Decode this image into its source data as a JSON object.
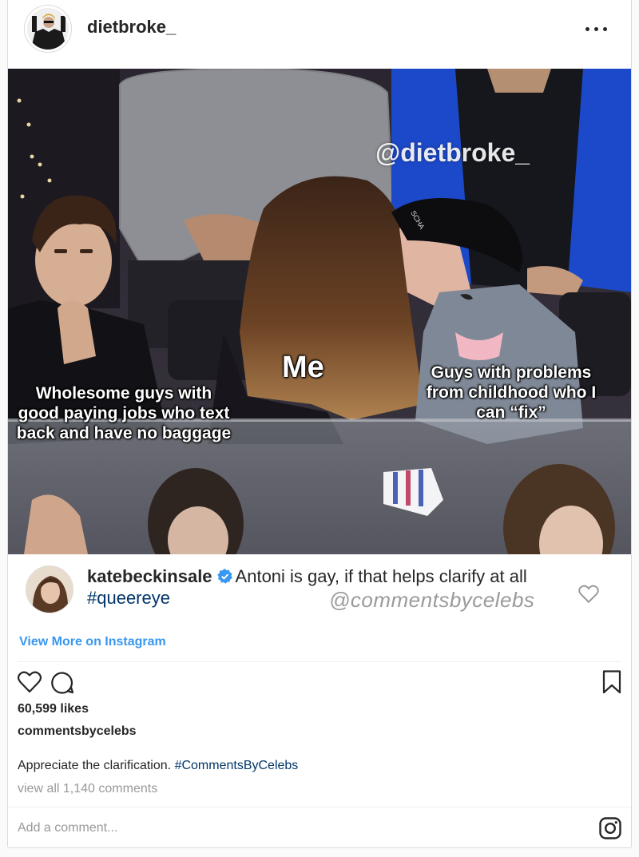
{
  "post": {
    "owner_username": "dietbroke_",
    "more_icon": "more-horizontal-icon"
  },
  "photo": {
    "watermark": "@dietbroke_",
    "label_center": "Me",
    "label_left": "Wholesome guys with good paying jobs who text back and have no baggage",
    "label_right": "Guys with problems from childhood who I can “fix”",
    "cap_text": "SCHA"
  },
  "comment": {
    "username": "katebeckinsale",
    "verified_icon": "verified-badge-icon",
    "text": "Antoni is gay, if that helps clarify at all",
    "hashtag": "#queereye",
    "watermark": "@commentsbycelebs",
    "like_icon": "heart-outline-icon"
  },
  "view_more_label": "View More on Instagram",
  "actions": {
    "like_icon": "heart-outline-icon",
    "comment_icon": "comment-bubble-icon",
    "save_icon": "bookmark-icon"
  },
  "likes_text": "60,599 likes",
  "caption": {
    "username": "commentsbycelebs",
    "text": "Appreciate the clarification.",
    "hashtag": "#CommentsByCelebs"
  },
  "view_all_comments": "view all 1,140 comments",
  "add_comment_placeholder": "Add a comment...",
  "colors": {
    "link_blue": "#3897f0",
    "hashtag": "#003569",
    "text": "#262626",
    "muted": "#999999",
    "verified": "#3897f0"
  }
}
